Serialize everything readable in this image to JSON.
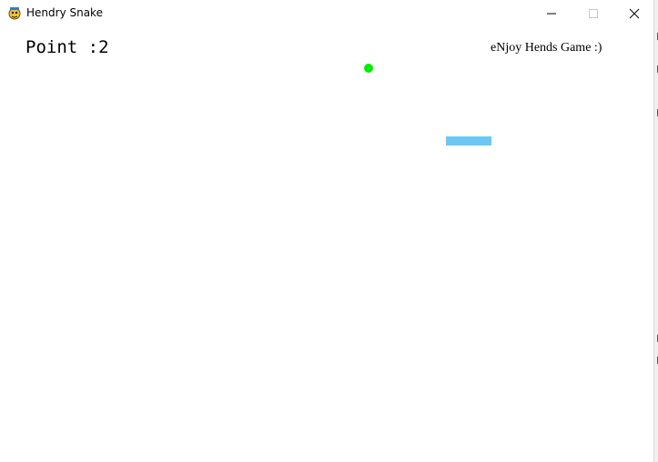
{
  "window": {
    "title": "Hendry Snake",
    "icon": "pygame-snake-icon",
    "controls": [
      "minimize-icon",
      "maximize-icon",
      "close-icon"
    ]
  },
  "game": {
    "score_text": "Point :2",
    "tagline": "eNjoy Hends Game :)",
    "colors": {
      "background": "#ffffff",
      "food": "#00ee00",
      "snake": "#6cc8f2"
    }
  }
}
